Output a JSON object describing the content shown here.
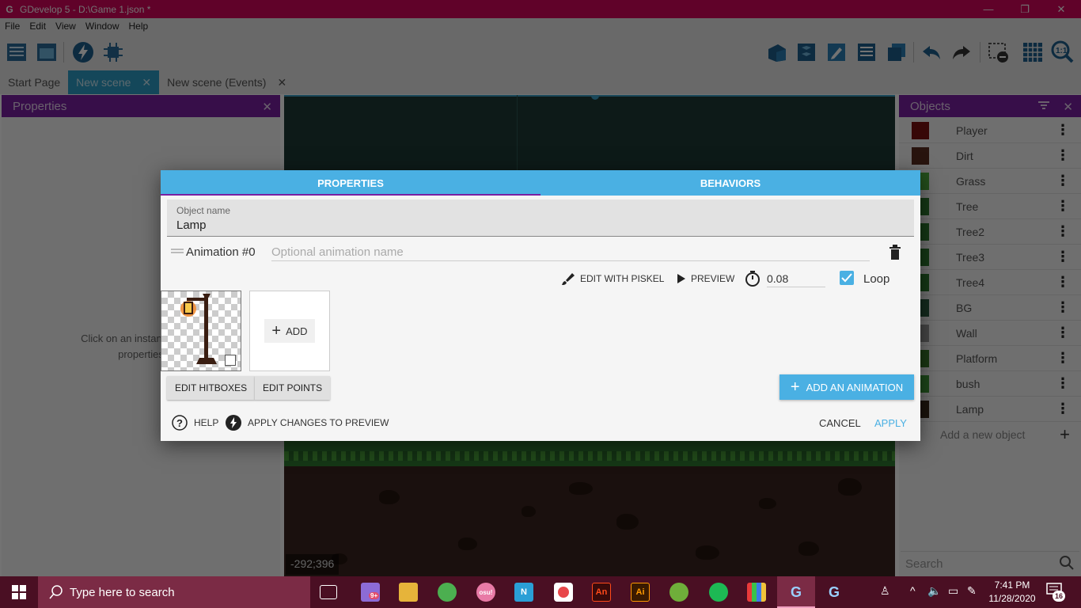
{
  "window": {
    "title": "GDevelop 5 - D:\\Game 1.json *",
    "minimize": "—",
    "restore": "❐",
    "close": "✕"
  },
  "menu": [
    "File",
    "Edit",
    "View",
    "Window",
    "Help"
  ],
  "tabs": [
    {
      "label": "Start Page"
    },
    {
      "label": "New scene",
      "active": true
    },
    {
      "label": "New scene (Events)"
    }
  ],
  "properties_panel": {
    "title": "Properties",
    "hint_line1": "Click on an instance in the",
    "hint_line2": "properties"
  },
  "canvas": {
    "coordinates": "-292;396"
  },
  "objects_panel": {
    "title": "Objects",
    "items": [
      {
        "name": "Player",
        "color": "#7a1010"
      },
      {
        "name": "Dirt",
        "color": "#5a2e20"
      },
      {
        "name": "Grass",
        "color": "#4fae3c"
      },
      {
        "name": "Tree",
        "color": "#2e7a30"
      },
      {
        "name": "Tree2",
        "color": "#2e7a30"
      },
      {
        "name": "Tree3",
        "color": "#2e7a30"
      },
      {
        "name": "Tree4",
        "color": "#2e7a30"
      },
      {
        "name": "BG",
        "color": "#2a5e40"
      },
      {
        "name": "Wall",
        "color": "#9a9a9a"
      },
      {
        "name": "Platform",
        "color": "#3a7a2a"
      },
      {
        "name": "bush",
        "color": "#3e9a38"
      },
      {
        "name": "Lamp",
        "color": "#3a2a1a"
      }
    ],
    "add_placeholder": "Add a new object",
    "search_placeholder": "Search"
  },
  "dialog": {
    "tabs": [
      {
        "label": "PROPERTIES",
        "active": true
      },
      {
        "label": "BEHAVIORS"
      }
    ],
    "object_name_label": "Object name",
    "object_name_value": "Lamp",
    "animation_label": "Animation #0",
    "animation_name_placeholder": "Optional animation name",
    "edit_with_piskel": "EDIT WITH PISKEL",
    "preview": "PREVIEW",
    "speed": "0.08",
    "loop_label": "Loop",
    "loop_checked": true,
    "add_sprite": "ADD",
    "edit_hitboxes": "EDIT HITBOXES",
    "edit_points": "EDIT POINTS",
    "add_animation": "ADD AN ANIMATION",
    "help": "HELP",
    "apply_changes": "APPLY CHANGES TO PREVIEW",
    "cancel": "CANCEL",
    "apply": "APPLY"
  },
  "taskbar": {
    "search_placeholder": "Type here to search",
    "time": "7:41 PM",
    "date": "11/28/2020",
    "notification_count": "16",
    "chat_badge": "9+"
  }
}
